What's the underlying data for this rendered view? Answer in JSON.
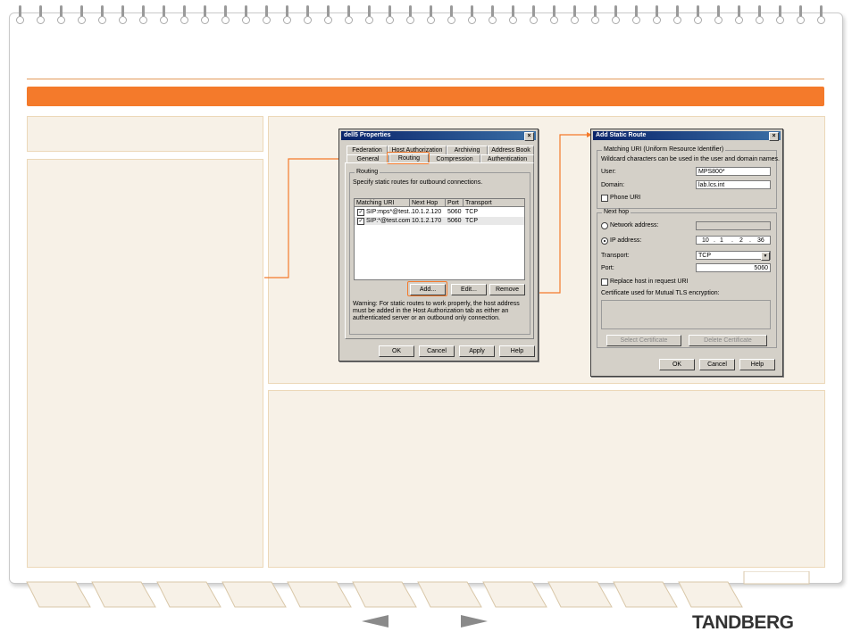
{
  "colors": {
    "accent": "#f47a2b",
    "panel": "#f7f1e7",
    "dialog_face": "#d4d0c8",
    "titlebar": "#0a246a"
  },
  "footer": {
    "prev_icon": "arrow-left-icon",
    "next_icon": "arrow-right-icon",
    "logo": "TANDBERG"
  },
  "properties_dialog": {
    "title": "dell5 Properties",
    "tabs_row1": [
      "Federation",
      "Host Authorization",
      "Archiving",
      "Address Book"
    ],
    "tabs_row2": [
      "General",
      "Routing",
      "Compression",
      "Authentication"
    ],
    "active_tab": "Routing",
    "group_title": "Routing",
    "description": "Specify static routes for outbound connections.",
    "columns": [
      "Matching URI",
      "Next Hop",
      "Port",
      "Transport"
    ],
    "rows": [
      {
        "checked": true,
        "uri": "SIP:mps*@test...",
        "next_hop": "10.1.2.120",
        "port": "5060",
        "transport": "TCP"
      },
      {
        "checked": true,
        "uri": "SIP:*@test.com",
        "next_hop": "10.1.2.170",
        "port": "5060",
        "transport": "TCP"
      }
    ],
    "buttons": {
      "add": "Add...",
      "edit": "Edit...",
      "remove": "Remove"
    },
    "warning": "Warning: For static routes to work properly, the host address must be added in the Host Authorization tab as either an authenticated server or an outbound only connection.",
    "footer_buttons": {
      "ok": "OK",
      "cancel": "Cancel",
      "apply": "Apply",
      "help": "Help"
    }
  },
  "static_route_dialog": {
    "title": "Add Static Route",
    "matching_group": "Matching URI (Uniform Resource Identifier)",
    "wildcard_note": "Wildcard characters can be used in the user and domain names.",
    "user_label": "User:",
    "user_value": "MPS800*",
    "domain_label": "Domain:",
    "domain_value": "lab.lcs.int",
    "phone_uri_label": "Phone URI",
    "next_hop_group": "Next hop",
    "network_address_label": "Network address:",
    "ip_address_label": "IP address:",
    "ip_octets": [
      "10",
      "1",
      "2",
      "36"
    ],
    "transport_label": "Transport:",
    "transport_value": "TCP",
    "port_label": "Port:",
    "port_value": "5060",
    "replace_host_label": "Replace host in request URI",
    "certificate_label": "Certificate used for Mutual TLS encryption:",
    "select_cert_button": "Select Certificate",
    "delete_cert_button": "Delete Certificate",
    "footer_buttons": {
      "ok": "OK",
      "cancel": "Cancel",
      "help": "Help"
    }
  }
}
